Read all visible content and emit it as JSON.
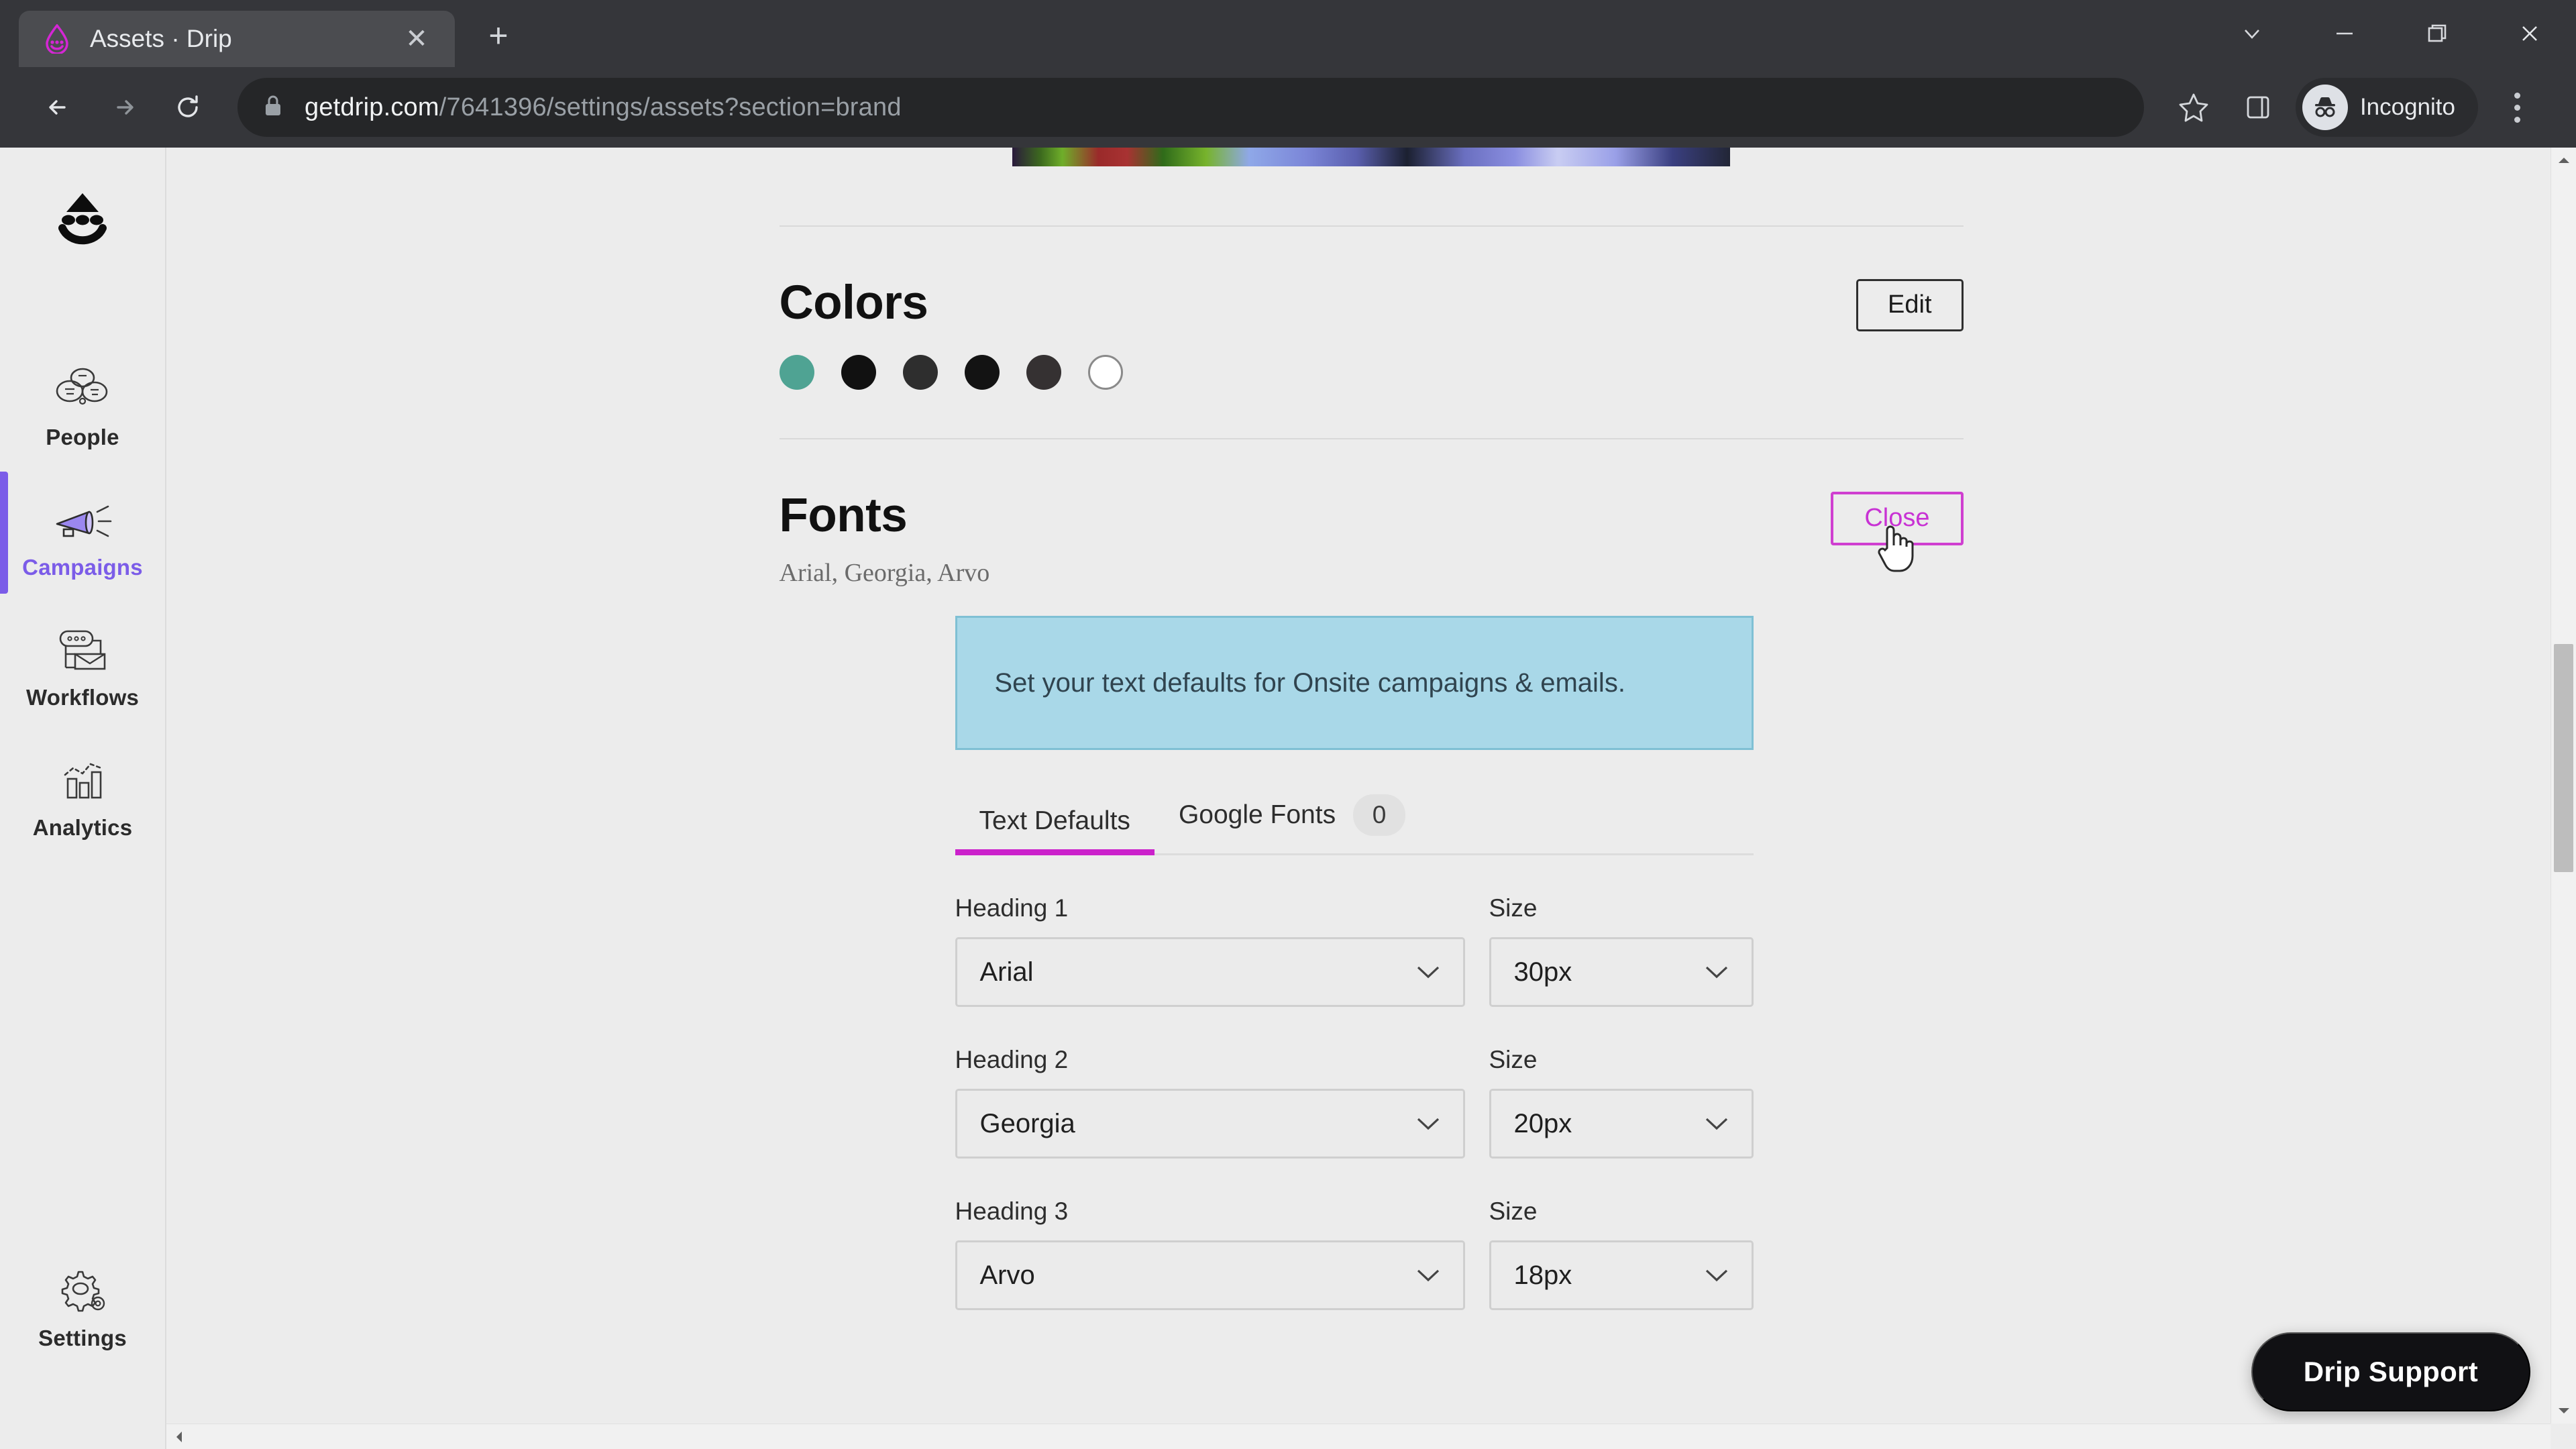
{
  "browser": {
    "tab": {
      "title": "Assets · Drip",
      "favicon": "drip-logo-icon",
      "close_icon": "close-icon"
    },
    "new_tab_label": "+",
    "window_controls": [
      {
        "name": "tab-search-button",
        "icon": "chevron-down-icon"
      },
      {
        "name": "minimize-button",
        "icon": "minimize-icon"
      },
      {
        "name": "maximize-restore-button",
        "icon": "restore-icon"
      },
      {
        "name": "close-window-button",
        "icon": "close-icon"
      }
    ],
    "nav": {
      "back_icon": "arrow-left-icon",
      "forward_icon": "arrow-right-icon",
      "reload_icon": "reload-icon"
    },
    "omnibox": {
      "lock_icon": "lock-icon",
      "url_host": "getdrip.com",
      "url_path": "/7641396/settings/assets?section=brand"
    },
    "bookmark_icon": "star-icon",
    "side_panel_icon": "side-panel-icon",
    "profile": {
      "label": "Incognito",
      "icon": "incognito-icon"
    },
    "menu_icon": "kebab-menu-icon"
  },
  "sidebar": {
    "logo": "drip-smiley-logo",
    "items": [
      {
        "label": "People",
        "icon": "people-icon",
        "active": false
      },
      {
        "label": "Campaigns",
        "icon": "megaphone-icon",
        "active": true
      },
      {
        "label": "Workflows",
        "icon": "workflow-icon",
        "active": false
      },
      {
        "label": "Analytics",
        "icon": "bar-chart-icon",
        "active": false
      },
      {
        "label": "Settings",
        "icon": "gear-icon",
        "active": false
      }
    ],
    "active_color": "#7b5ce8"
  },
  "main": {
    "colors_section": {
      "title": "Colors",
      "edit_label": "Edit",
      "swatches": [
        "#4fa393",
        "#111111",
        "#2e2e2e",
        "#131313",
        "#353132",
        "#ffffff"
      ]
    },
    "fonts_section": {
      "title": "Fonts",
      "subtitle": "Arial, Georgia, Arvo",
      "close_label": "Close",
      "close_accent": "#cb21cb",
      "banner_text": "Set your text defaults for Onsite campaigns & emails.",
      "banner_bg": "#a9d8e8",
      "tabs": [
        {
          "label": "Text Defaults",
          "badge": null,
          "active": true
        },
        {
          "label": "Google Fonts",
          "badge": "0",
          "active": false
        }
      ],
      "size_label": "Size",
      "fields": [
        {
          "label": "Heading 1",
          "font": "Arial",
          "size": "30px"
        },
        {
          "label": "Heading 2",
          "font": "Georgia",
          "size": "20px"
        },
        {
          "label": "Heading 3",
          "font": "Arvo",
          "size": "18px"
        }
      ]
    },
    "support_button": "Drip Support"
  }
}
